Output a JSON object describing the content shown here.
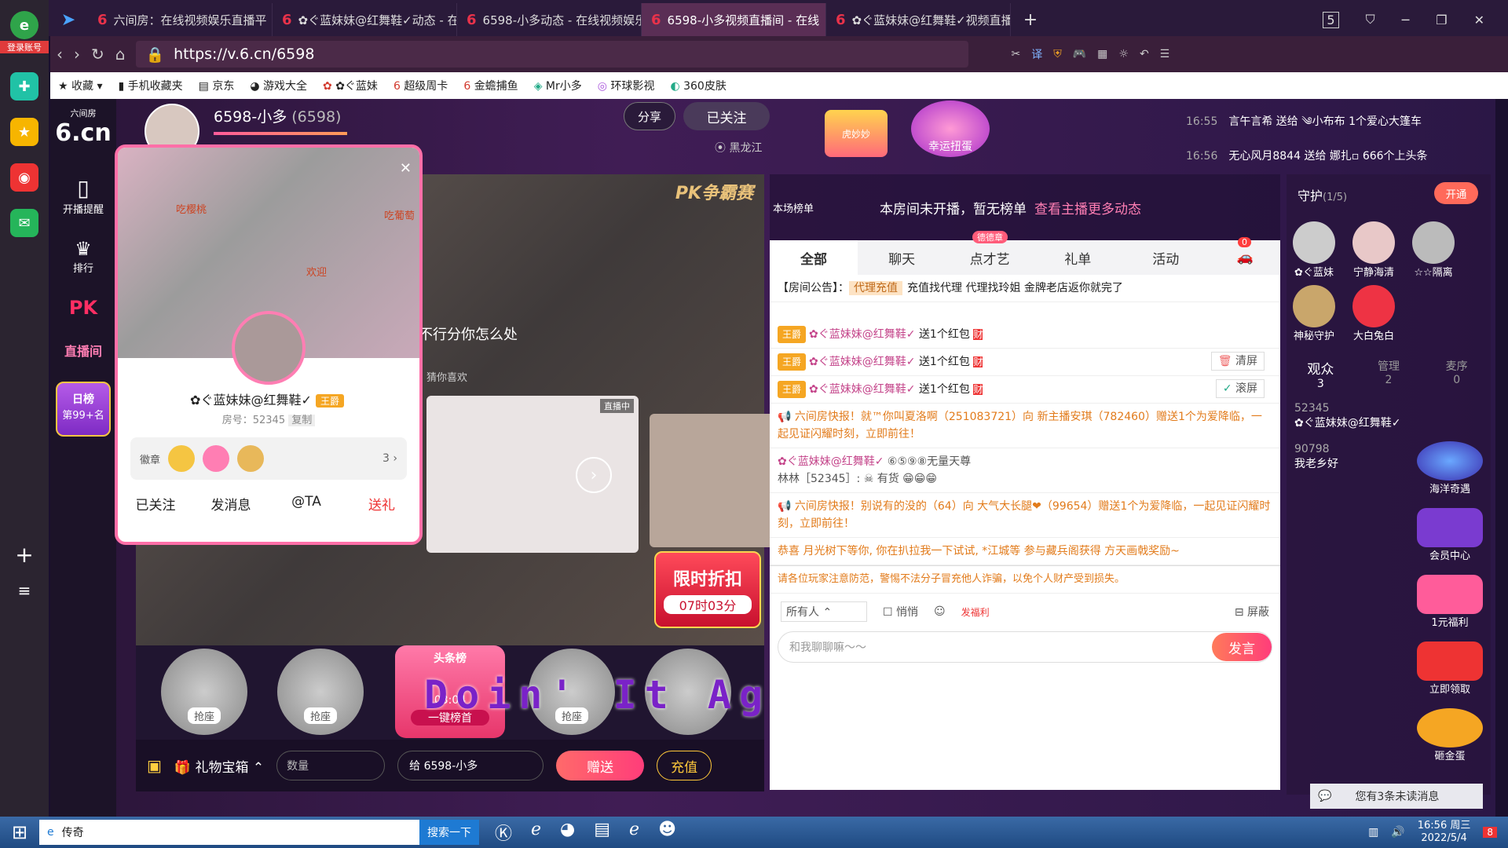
{
  "browser": {
    "tabs": [
      {
        "title": "六间房：在线视频娱乐直播平"
      },
      {
        "title": "✿ぐ蓝妹妹@红舞鞋✓动态 - 在"
      },
      {
        "title": "6598-小多动态 - 在线视频娱乐"
      },
      {
        "title": "6598-小多视频直播间 - 在线"
      },
      {
        "title": "✿ぐ蓝妹妹@红舞鞋✓视频直播"
      }
    ],
    "tab_count": "5",
    "url": "https://v.6.cn/6598",
    "bookmarks": [
      "收藏",
      "手机收藏夹",
      "京东",
      "游戏大全",
      "✿ぐ蓝妹",
      "超级周卡",
      "金蟾捕鱼",
      "Mr小多",
      "环球影视",
      "360皮肤"
    ],
    "translate_label": "译",
    "login_label": "登录账号"
  },
  "site": {
    "logo": "6.cn",
    "logo_sub": "六间房",
    "nav": [
      {
        "label": "开播提醒"
      },
      {
        "label": "排行"
      },
      {
        "label": "PK"
      },
      {
        "label": "直播间"
      }
    ],
    "daily_rank_title": "日榜",
    "daily_rank_value": "第99+名"
  },
  "anchor": {
    "name": "6598-小多",
    "id": "(6598)",
    "share_label": "分享",
    "follow_label": "已关注",
    "location": "黑龙江",
    "gift_banner_left": "虎妙妙",
    "gift_banner_right": "幸运扭蛋"
  },
  "ticker": [
    {
      "time": "16:55",
      "text": "言午言希 送给 ༄小布布 1个爱心大篷车"
    },
    {
      "time": "16:56",
      "text": "无心风月8844 送给 娜扎▫ 666个上头条"
    }
  ],
  "ranking": {
    "label": "本场榜单",
    "notice": "本房间未开播，暂无榜单",
    "link": "查看主播更多动态"
  },
  "video": {
    "pk_label": "PK争霸赛",
    "overlay_text": "不行分你怎么处",
    "guess_label": "猜你喜欢",
    "live_badge": "直播中",
    "discount": "限时折扣",
    "discount_time": "07时03分",
    "seat_label": "抢座",
    "rank_banner": "头条榜",
    "rank_time": "03:04",
    "rank_button": "一键榜首",
    "marquee": "Doin' It Again - DJ Volume"
  },
  "gift_bar": {
    "box_label": "礼物宝箱",
    "quantity_placeholder": "数量",
    "to_label": "给 6598-小多",
    "send_label": "赠送",
    "recharge_label": "充值"
  },
  "chat": {
    "tabs": [
      "全部",
      "聊天",
      "点才艺",
      "礼单",
      "活动"
    ],
    "tab_badge": "德德章",
    "car_count": "0",
    "announce_label": "【房间公告】：",
    "announce_tag": "代理充值",
    "announce_text": "充值找代理 代理找玲姐 金牌老店返你就完了",
    "messages": [
      {
        "type": "gift",
        "badge": "王爵",
        "user": "✿ぐ蓝妹妹@红舞鞋✓",
        "text": "送1个红包"
      },
      {
        "type": "gift",
        "badge": "王爵",
        "user": "✿ぐ蓝妹妹@红舞鞋✓",
        "text": "送1个红包"
      },
      {
        "type": "gift",
        "badge": "王爵",
        "user": "✿ぐ蓝妹妹@红舞鞋✓",
        "text": "送1个红包"
      },
      {
        "type": "news",
        "text": "六间房快报！就™你叫夏洛啊（251083721）向 新主播安琪（782460）赠送1个为爱降临，一起见证闪耀时刻，立即前往！"
      },
      {
        "type": "chat",
        "user": "✿ぐ蓝妹妹@红舞鞋✓",
        "extra": "⑥⑤⑨⑧无量天尊",
        "line2": "林林［52345］: ☠ 有货 😁😁😁"
      },
      {
        "type": "news",
        "text": "六间房快报！别说有的没的（64）向 大气大长腿❤（99654）赠送1个为爱降临，一起见证闪耀时刻，立即前往！"
      },
      {
        "type": "congrats",
        "text": "恭喜 月光树下等你, 你在扒拉我一下试试, *江城等 参与藏兵阁获得 方天画戟奖励~"
      }
    ],
    "warning": "请各位玩家注意防范，警惕不法分子冒充他人诈骗，以免个人财产受到损失。",
    "clear_label": "清屏",
    "scroll_label": "滚屏",
    "recipient": "所有人",
    "whisper": "悄悄",
    "welfare": "发福利",
    "shield": "屏蔽",
    "input_placeholder": "和我聊聊嘛～～",
    "send_label": "发言",
    "unread": "您有3条未读消息"
  },
  "guard": {
    "title": "守护",
    "count": "(1/5)",
    "open_label": "开通",
    "members": [
      "✿ぐ蓝妹",
      "宁静海清",
      "☆☆隔离",
      "神秘守护",
      "大白兔白"
    ],
    "tabs": [
      {
        "label": "观众",
        "count": "3"
      },
      {
        "label": "管理",
        "count": "2"
      },
      {
        "label": "麦序",
        "count": "0"
      }
    ],
    "viewers": [
      {
        "id": "52345",
        "name": "✿ぐ蓝妹妹@红舞鞋✓"
      },
      {
        "id": "90798",
        "name": "我老乡好"
      }
    ],
    "promos": [
      "海洋奇遇",
      "会员中心",
      "1元福利",
      "立即领取",
      "砸金蛋"
    ]
  },
  "popup": {
    "name": "✿ぐ蓝妹妹@红舞鞋✓",
    "level_badge": "王爵",
    "room_no": "房号：52345",
    "copy_label": "复制",
    "medal_label": "徽章",
    "medal_count": "3",
    "actions": [
      "已关注",
      "发消息",
      "@TA",
      "送礼"
    ],
    "stickers": [
      "吃樱桃",
      "吃葡萄",
      "欢迎"
    ]
  },
  "taskbar": {
    "search_text": "传奇",
    "search_button": "搜索一下",
    "time": "16:56 周三",
    "date": "2022/5/4",
    "notify_count": "8"
  }
}
